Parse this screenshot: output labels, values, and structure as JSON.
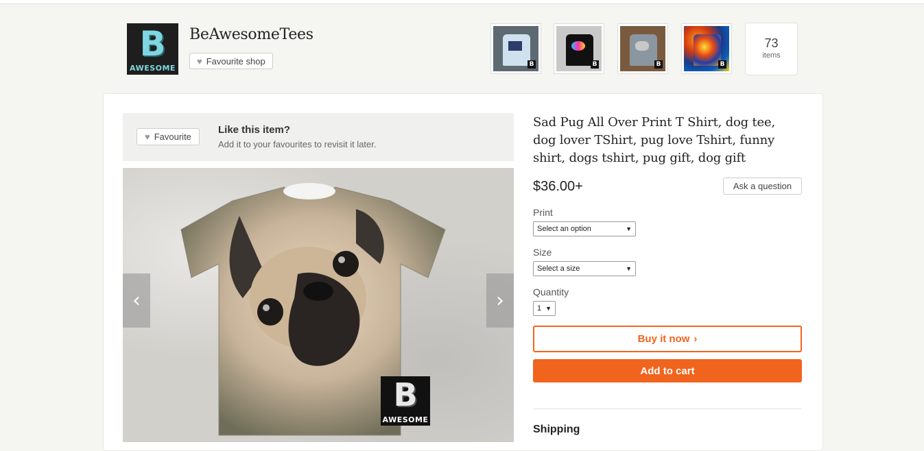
{
  "shop": {
    "name": "BeAwesomeTees",
    "logo_letter": "B",
    "logo_word": "AWESOME",
    "favourite_label": "Favourite shop",
    "items_count": "73",
    "items_label": "items",
    "thumbnails": [
      {
        "name": "thumb-tee-light-blue",
        "mark": "B"
      },
      {
        "name": "thumb-tee-black",
        "mark": "B"
      },
      {
        "name": "thumb-tee-elephant",
        "mark": "B"
      },
      {
        "name": "thumb-tee-tie-dye",
        "mark": "B"
      }
    ]
  },
  "favourite_bar": {
    "button_label": "Favourite",
    "title": "Like this item?",
    "subtitle": "Add it to your favourites to revisit it later."
  },
  "gallery": {
    "prev_icon": "‹",
    "next_icon": "›",
    "watermark_letter": "B",
    "watermark_word": "AWESOME"
  },
  "listing": {
    "title": "Sad Pug All Over Print T Shirt, dog tee, dog lover TShirt, pug love Tshirt, funny shirt, dogs tshirt, pug gift, dog gift",
    "price": "$36.00+",
    "ask_question": "Ask a question",
    "print_label": "Print",
    "print_value": "Select an option",
    "size_label": "Size",
    "size_value": "Select a size",
    "quantity_label": "Quantity",
    "quantity_value": "1",
    "buy_now": "Buy it now",
    "add_to_cart": "Add to cart",
    "shipping_heading": "Shipping"
  },
  "colors": {
    "accent": "#f1641e",
    "page_bg": "#f5f5f1"
  }
}
